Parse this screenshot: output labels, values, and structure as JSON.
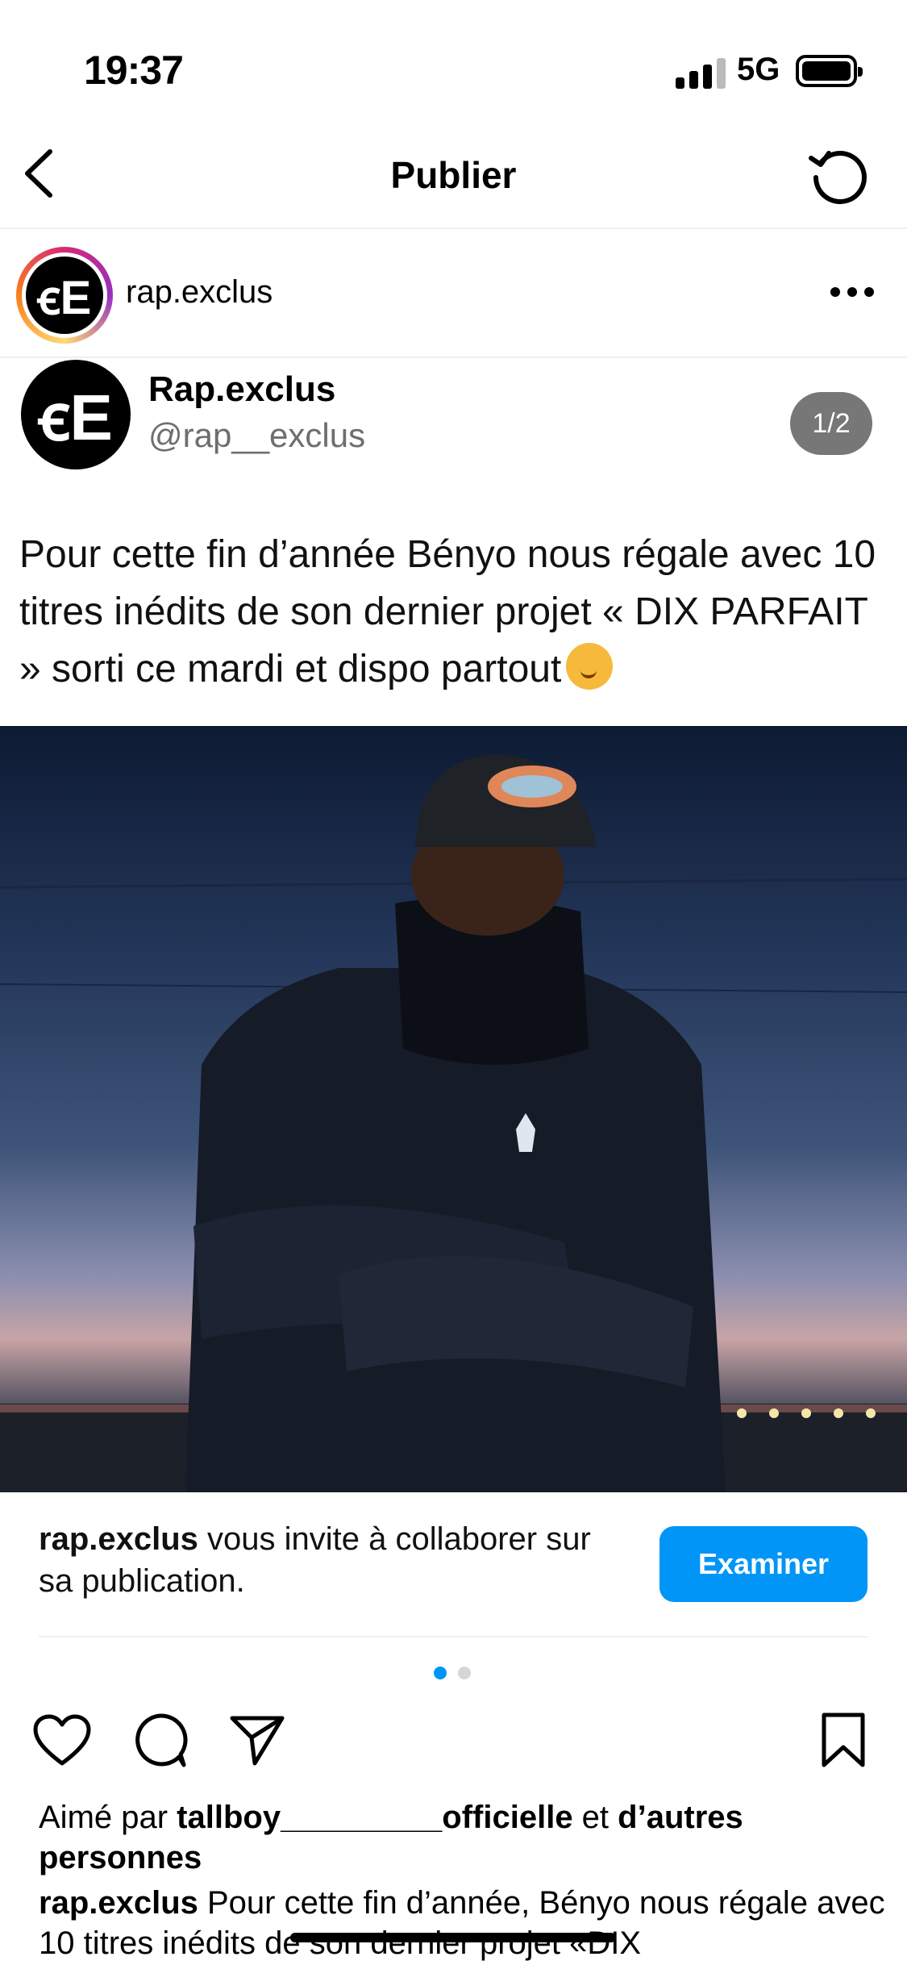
{
  "status": {
    "time": "19:37",
    "network": "5G"
  },
  "header": {
    "title": "Publier"
  },
  "account": {
    "username": "rap.exclus",
    "avatar_glyph": "ꞓE"
  },
  "tweet": {
    "name": "Rap.exclus",
    "handle": "@rap__exclus",
    "pager": "1/2",
    "text": "Pour cette fin d’année Bényo nous régale avec 10 titres inédits de son dernier projet « DIX PARFAIT » sorti ce mardi et dispo partout",
    "emoji": "partying-face-emoji"
  },
  "collab": {
    "user": "rap.exclus",
    "message": " vous invite à collaborer sur sa publication.",
    "button": "Examiner"
  },
  "carousel": {
    "index": 1,
    "count": 2
  },
  "likes": {
    "prefix": "Aimé par ",
    "user": "tallboy_________officielle",
    "middle": " et ",
    "suffix": "d’autres personnes"
  },
  "caption": {
    "user": "rap.exclus",
    "text": " Pour cette fin d’année, Bényo nous régale avec 10 titres inédits de son dernier projet «DIX"
  },
  "colors": {
    "accent": "#0095f6",
    "handle": "#6e6e6e",
    "pager_bg": "#777777"
  }
}
